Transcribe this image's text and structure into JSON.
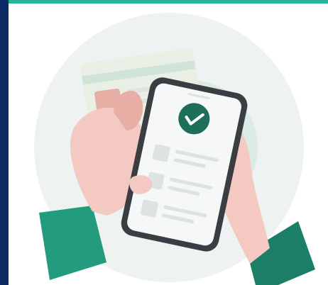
{
  "colors": {
    "top_bar": "#27b59a",
    "left_bar": "#0c2a63",
    "background": "#ffffff",
    "backdrop_circle": "#eef3f1",
    "inner_circle": "#dcebe6",
    "skin": "#f3c9c2",
    "skin_shadow": "#e7aea6",
    "sleeve": "#239c7d",
    "sleeve_dark": "#1a7f66",
    "phone_frame": "#3a3d42",
    "phone_screen": "#f6f8f7",
    "check_circle": "#1d6f5a",
    "check_mark": "#ffffff",
    "list_placeholder": "#dde3e1",
    "id_card": "#e9efe4",
    "id_card_stripe": "#cfe3d6"
  },
  "icons": {
    "verified": "check-circle-icon",
    "checkbox": "checkbox-icon"
  },
  "checklist_items": 3
}
